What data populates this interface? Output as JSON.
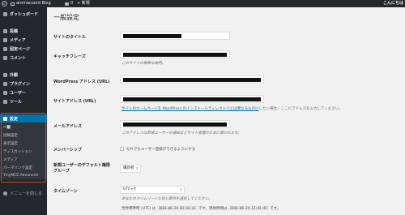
{
  "adminbar": {
    "logo": "W",
    "site_name": "aromacoord Blog",
    "comment_count": "0",
    "new_label": "+ 新規",
    "howdy": "こんにちは"
  },
  "sidebar": {
    "items": [
      {
        "label": "ダッシュボード",
        "icon": "dashboard-icon"
      },
      {
        "label": "投稿",
        "icon": "pin-icon"
      },
      {
        "label": "メディア",
        "icon": "media-icon"
      },
      {
        "label": "固定ページ",
        "icon": "page-icon"
      },
      {
        "label": "コメント",
        "icon": "comment-icon"
      },
      {
        "label": "外観",
        "icon": "brush-icon"
      },
      {
        "label": "プラグイン",
        "icon": "plugin-icon"
      },
      {
        "label": "ユーザー",
        "icon": "user-icon"
      },
      {
        "label": "ツール",
        "icon": "wrench-icon"
      },
      {
        "label": "設定",
        "icon": "settings-icon"
      }
    ],
    "submenu": [
      "一般",
      "投稿設定",
      "表示設定",
      "ディスカッション",
      "メディア",
      "パーマリンク設定",
      "TinyMCE Advanced"
    ],
    "collapse_label": "メニューを閉じる"
  },
  "main": {
    "title": "一般設定",
    "site_title_label": "サイトのタイトル",
    "tagline_label": "キャッチフレーズ",
    "tagline_desc": "このサイトの簡単な説明。",
    "wp_address_label": "WordPress アドレス (URL)",
    "site_address_label": "サイトアドレス (URL)",
    "site_address_desc_link": "サイトのホームページを WordPress のインストールディレクトリとは異なるものに",
    "site_address_desc_rest": "したい場合、ここにアドレスを入力してください。",
    "email_label": "メールアドレス",
    "email_desc": "このアドレスは新規ユーザーの通知などサイト管理のために使われます。",
    "membership_label": "メンバーシップ",
    "membership_checkbox_label": "だれでもユーザー登録ができるようにする",
    "default_role_label_1": "新規ユーザーのデフォルト権限",
    "default_role_label_2": "グループ",
    "default_role_value": "購読者",
    "timezone_label": "タイムゾーン",
    "timezone_value": "UTC+9",
    "timezone_desc": "あなたのタイムゾーンと同じ都市を選択してください。",
    "utc_prefix": "世界標準時 (UTC) は",
    "utc_time": "2016-06-24 03:43:42",
    "utc_mid": "です。現地時間は",
    "local_time": "2016-06-24 12:43:42",
    "utc_suffix": "です。"
  }
}
